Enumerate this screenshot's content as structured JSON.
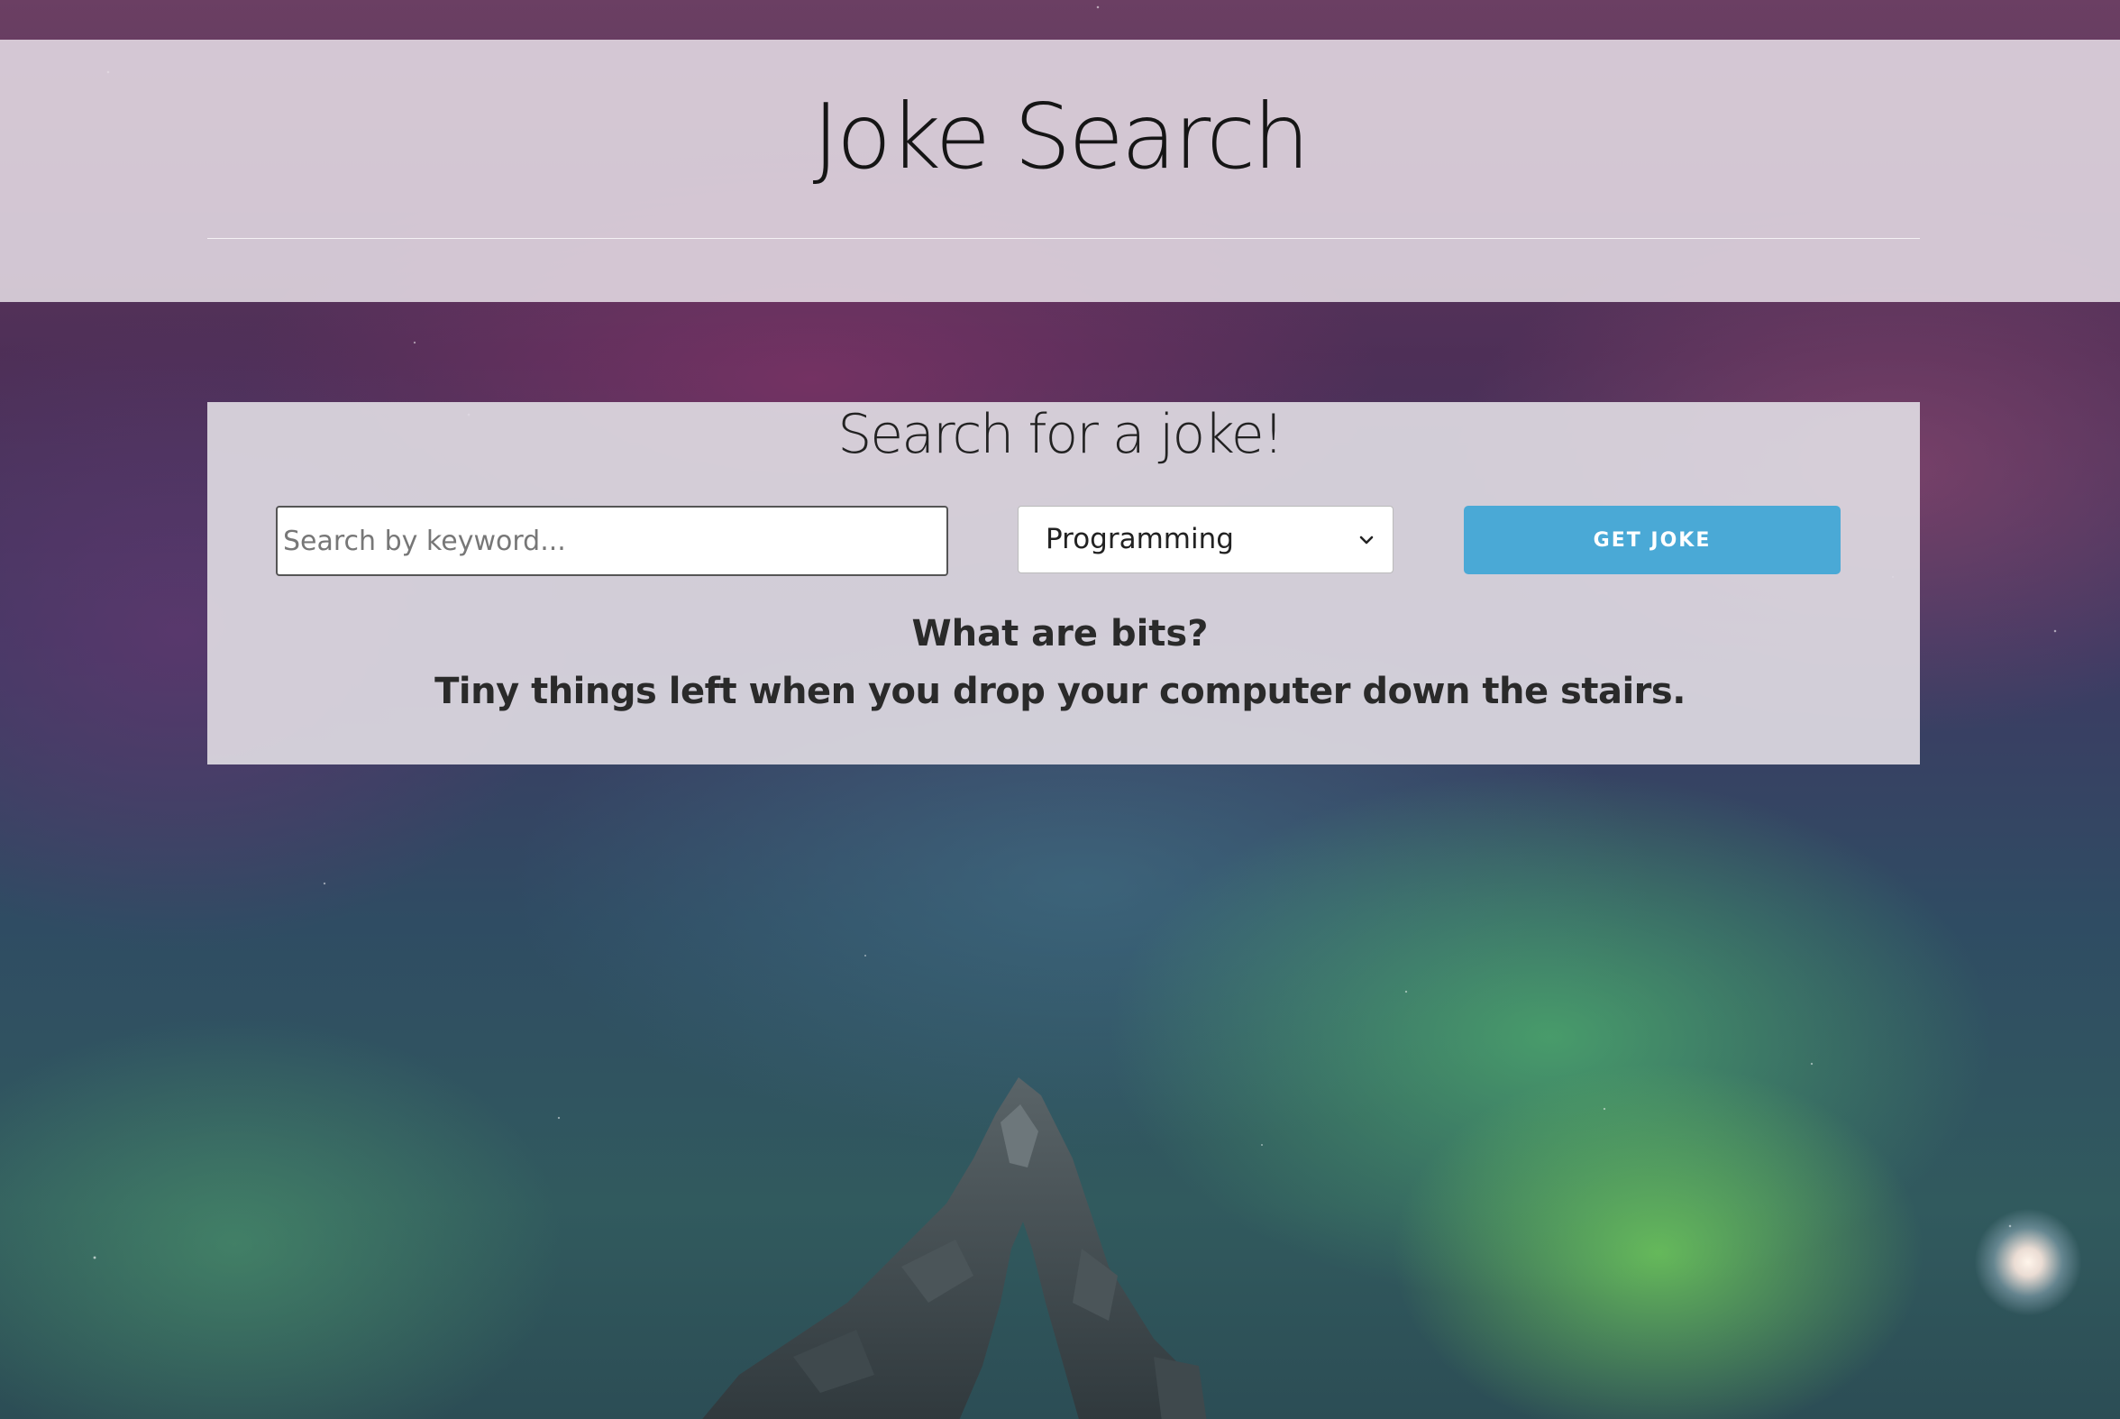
{
  "header": {
    "title": "Joke Search"
  },
  "search_panel": {
    "heading": "Search for a joke!",
    "keyword_input": {
      "placeholder": "Search by keyword...",
      "value": ""
    },
    "category_select": {
      "selected": "Programming"
    },
    "submit_label": "GET JOKE"
  },
  "joke": {
    "setup": "What are bits?",
    "punchline": "Tiny things left when you drop your computer down the stairs."
  },
  "icons": {
    "select_arrow": "chevron-down-icon"
  },
  "colors": {
    "button": "#4aa9d6",
    "button_text": "#ffffff",
    "panel_bg": "#dedae2",
    "text": "#2a2a2a"
  }
}
